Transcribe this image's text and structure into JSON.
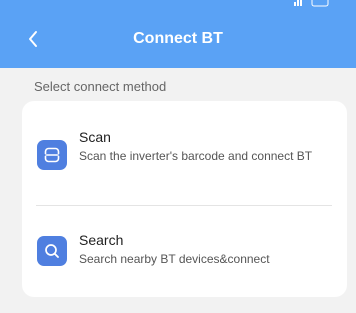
{
  "nav": {
    "title": "Connect BT"
  },
  "section_label": "Select connect method",
  "methods": [
    {
      "title": "Scan",
      "description": "Scan the inverter's barcode and connect BT",
      "icon": "scan-icon"
    },
    {
      "title": "Search",
      "description": "Search nearby BT devices&connect",
      "icon": "search-icon"
    }
  ],
  "colors": {
    "header": "#5aa2f5",
    "icon_background": "#4f7fe0",
    "page_background": "#f2f2f2",
    "card_background": "#ffffff"
  }
}
